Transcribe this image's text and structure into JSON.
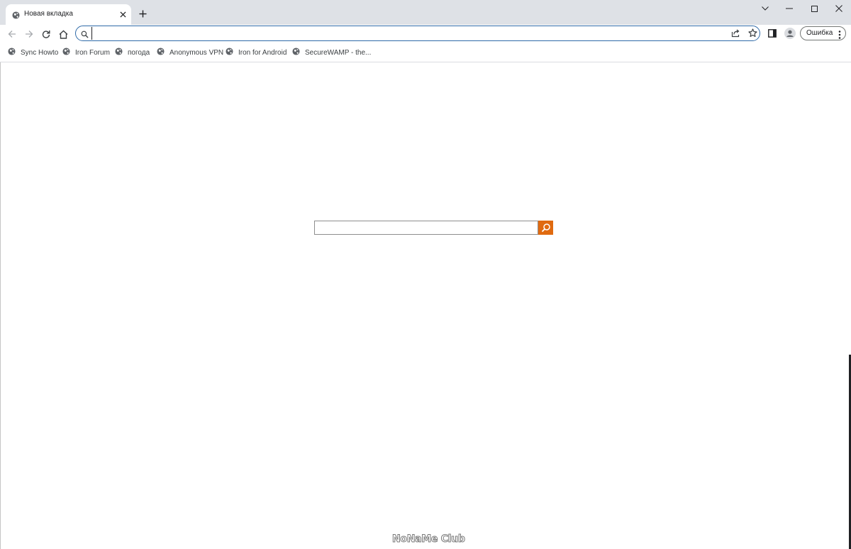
{
  "tab": {
    "title": "Новая вкладка",
    "favicon": "globe-icon",
    "close_icon": "close-icon"
  },
  "new_tab_icon": "plus-icon",
  "window_controls": [
    "chevron-down-icon",
    "minimize-icon",
    "maximize-icon",
    "close-icon"
  ],
  "toolbar": {
    "back_icon": "back-arrow-icon",
    "forward_icon": "forward-arrow-icon",
    "reload_icon": "reload-icon",
    "home_icon": "home-icon",
    "omnibox": {
      "value": "",
      "search_icon": "search-icon",
      "share_icon": "share-icon",
      "bookmark_icon": "star-icon"
    },
    "side_panel_icon": "side-panel-icon",
    "profile_icon": "person-icon",
    "error_label": "Ошибка",
    "menu_icon": "kebab-menu-icon"
  },
  "bookmarks": [
    {
      "label": "Sync Howto",
      "icon": "globe-icon"
    },
    {
      "label": "Iron Forum",
      "icon": "globe-icon"
    },
    {
      "label": "погода",
      "icon": "globe-icon"
    },
    {
      "label": "Anonymous VPN",
      "icon": "globe-icon"
    },
    {
      "label": "Iron for Android",
      "icon": "globe-icon"
    },
    {
      "label": "SecureWAMP - the...",
      "icon": "globe-icon"
    }
  ],
  "page": {
    "search_value": "",
    "search_button_icon": "search-icon",
    "search_button_color": "#e06a10"
  },
  "watermark": "NoNaMe Club",
  "colors": {
    "tabstrip": "#dee1e6",
    "omnibox_border": "#2f6aa8",
    "accent_orange": "#e06a10"
  }
}
